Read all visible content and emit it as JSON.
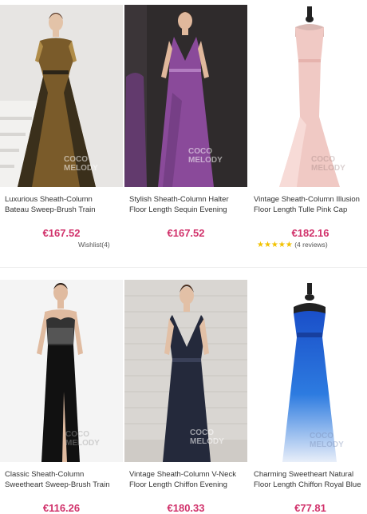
{
  "brand_watermark": "COCO MELODY",
  "products": [
    {
      "title_line1": "Luxurious Sheath-Column",
      "title_line2": "Bateau Sweep-Brush Train",
      "price": "€167.52",
      "wishlist": "Wishlist(4)",
      "colors": {
        "bg": "#e7e5e3",
        "dress": "#7a5b2a",
        "accent": "#2b2418"
      }
    },
    {
      "title_line1": "Stylish Sheath-Column Halter",
      "title_line2": "Floor Length Sequin Evening",
      "price": "€167.52",
      "colors": {
        "bg": "#2f2b2c",
        "dress": "#8a4a9a",
        "accent": "#b27cc0"
      }
    },
    {
      "title_line1": "Vintage Sheath-Column Illusion",
      "title_line2": "Floor Length Tulle Pink Cap",
      "price": "€182.16",
      "rating": 5,
      "reviews": "(4 reviews)",
      "colors": {
        "bg": "#ffffff",
        "dress": "#f0c9c4",
        "accent": "#e6b3ad"
      }
    },
    {
      "title_line1": "Classic Sheath-Column",
      "title_line2": "Sweetheart Sweep-Brush Train",
      "price": "€116.26",
      "colors": {
        "bg": "#f4f4f4",
        "dress": "#111111",
        "accent": "#777777"
      }
    },
    {
      "title_line1": "Vintage Sheath-Column V-Neck",
      "title_line2": "Floor Length Chiffon Evening",
      "price": "€180.33",
      "colors": {
        "bg": "#d9d6d2",
        "dress": "#24293b",
        "accent": "#3a4058"
      }
    },
    {
      "title_line1": "Charming Sweetheart Natural",
      "title_line2": "Floor Length Chiffon Royal Blue",
      "price": "€77.81",
      "colors": {
        "bg": "#ffffff",
        "dress": "#1f5fd6",
        "accent": "#e8eef9"
      }
    }
  ]
}
